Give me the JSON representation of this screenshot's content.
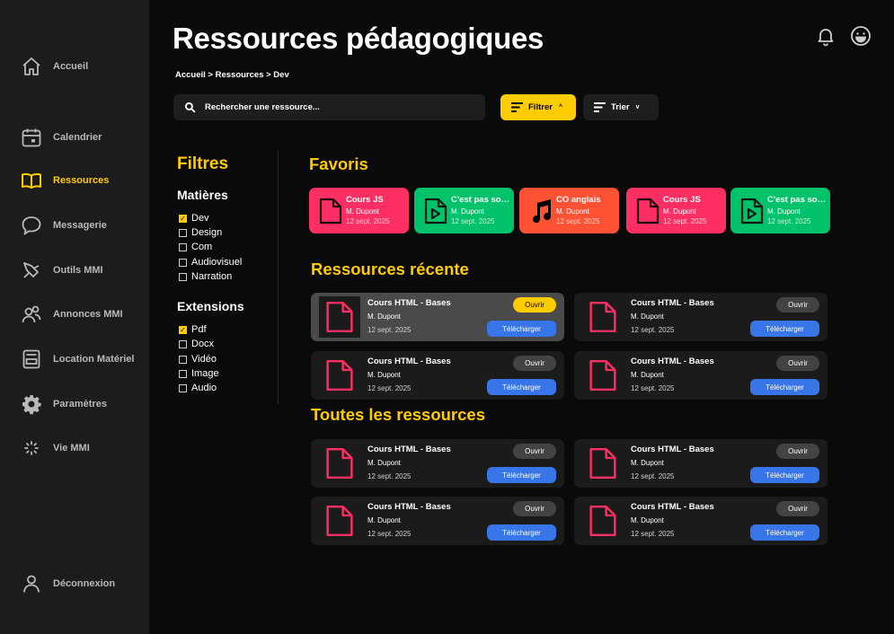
{
  "colors": {
    "accent": "#ffcc00",
    "blue": "#3875e8",
    "pink": "#ff2e63",
    "green": "#00c26b",
    "orange": "#ff5133"
  },
  "sidebar": {
    "items": [
      {
        "label": "Accueil",
        "icon": "home-icon"
      },
      {
        "label": "Calendrier",
        "icon": "calendar-icon"
      },
      {
        "label": "Ressources",
        "icon": "book-icon",
        "active": true
      },
      {
        "label": "Messagerie",
        "icon": "chat-icon"
      },
      {
        "label": "Outils MMI",
        "icon": "tools-icon"
      },
      {
        "label": "Annonces MMI",
        "icon": "users-icon"
      },
      {
        "label": "Location Matériel",
        "icon": "locker-icon"
      },
      {
        "label": "Paramètres",
        "icon": "gear-icon"
      },
      {
        "label": "Vie MMI",
        "icon": "spark-icon"
      }
    ],
    "logout": {
      "label": "Déconnexion",
      "icon": "user-icon"
    }
  },
  "header": {
    "title": "Ressources pédagogiques",
    "breadcrumb": "Accueil > Ressources > Dev",
    "search_placeholder": "Rechercher une ressource...",
    "filter_label": "Filtrer",
    "filter_chevron": "^",
    "sort_label": "Trier",
    "sort_chevron": "v"
  },
  "filters": {
    "title": "Filtres",
    "groups": [
      {
        "title": "Matières",
        "options": [
          {
            "label": "Dev",
            "checked": true
          },
          {
            "label": "Design",
            "checked": false
          },
          {
            "label": "Com",
            "checked": false
          },
          {
            "label": "Audiovisuel",
            "checked": false
          },
          {
            "label": "Narration",
            "checked": false
          }
        ]
      },
      {
        "title": "Extensions",
        "options": [
          {
            "label": "Pdf",
            "checked": true
          },
          {
            "label": "Docx",
            "checked": false
          },
          {
            "label": "Vidéo",
            "checked": false
          },
          {
            "label": "Image",
            "checked": false
          },
          {
            "label": "Audio",
            "checked": false
          }
        ]
      }
    ]
  },
  "favorites": {
    "title": "Favoris",
    "items": [
      {
        "title": "Cours JS",
        "author": "M. Dupont",
        "date": "12 sept. 2025",
        "type": "pdf",
        "color": "#ff2e63"
      },
      {
        "title": "C'est pas sorcier",
        "author": "M. Dupont",
        "date": "12 sept. 2025",
        "type": "video",
        "color": "#00c26b"
      },
      {
        "title": "CO anglais",
        "author": "M. Dupont",
        "date": "12 sept. 2025",
        "type": "audio",
        "color": "#ff5133"
      },
      {
        "title": "Cours JS",
        "author": "M. Dupont",
        "date": "12 sept. 2025",
        "type": "pdf",
        "color": "#ff2e63"
      },
      {
        "title": "C'est pas sorcier",
        "author": "M. Dupont",
        "date": "12 sept. 2025",
        "type": "video",
        "color": "#00c26b"
      }
    ]
  },
  "recent": {
    "title": "Ressources récente",
    "items": [
      {
        "title": "Cours HTML - Bases",
        "author": "M. Dupont",
        "date": "12 sept. 2025",
        "open_label": "Ouvrir",
        "download_label": "Télécharger",
        "highlighted": true
      },
      {
        "title": "Cours HTML - Bases",
        "author": "M. Dupont",
        "date": "12 sept. 2025",
        "open_label": "Ouvrir",
        "download_label": "Télécharger"
      },
      {
        "title": "Cours HTML - Bases",
        "author": "M. Dupont",
        "date": "12 sept. 2025",
        "open_label": "Ouvrir",
        "download_label": "Télécharger"
      },
      {
        "title": "Cours HTML - Bases",
        "author": "M. Dupont",
        "date": "12 sept. 2025",
        "open_label": "Ouvrir",
        "download_label": "Télécharger"
      }
    ]
  },
  "all": {
    "title": "Toutes les ressources",
    "items": [
      {
        "title": "Cours HTML - Bases",
        "author": "M. Dupont",
        "date": "12 sept. 2025",
        "open_label": "Ouvrir",
        "download_label": "Télécharger"
      },
      {
        "title": "Cours HTML - Bases",
        "author": "M. Dupont",
        "date": "12 sept. 2025",
        "open_label": "Ouvrir",
        "download_label": "Télécharger"
      },
      {
        "title": "Cours HTML - Bases",
        "author": "M. Dupont",
        "date": "12 sept. 2025",
        "open_label": "Ouvrir",
        "download_label": "Télécharger"
      },
      {
        "title": "Cours HTML - Bases",
        "author": "M. Dupont",
        "date": "12 sept. 2025",
        "open_label": "Ouvrir",
        "download_label": "Télécharger"
      }
    ]
  }
}
